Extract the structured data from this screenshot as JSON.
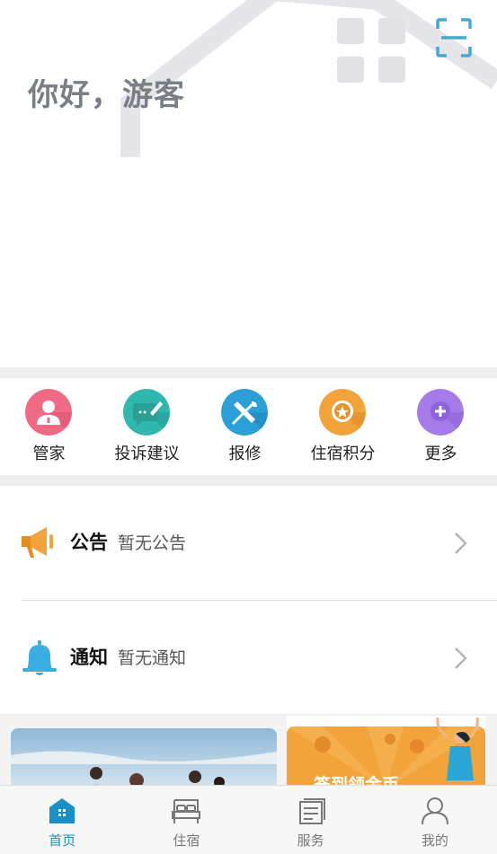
{
  "header": {
    "greeting": "你好，游客",
    "grid_icon": "apps-grid-icon",
    "scan_icon": "scan-icon"
  },
  "quick_menu": [
    {
      "label": "管家",
      "icon": "butler-icon",
      "color": "#f06a86"
    },
    {
      "label": "投诉建议",
      "icon": "feedback-icon",
      "color": "#2fb8ad"
    },
    {
      "label": "报修",
      "icon": "repair-icon",
      "color": "#2a9fd8"
    },
    {
      "label": "住宿积分",
      "icon": "points-icon",
      "color": "#f2a33a"
    },
    {
      "label": "更多",
      "icon": "more-icon",
      "color": "#a57be8"
    }
  ],
  "notices": {
    "announcement": {
      "title": "公告",
      "value": "暂无公告",
      "icon": "megaphone-icon"
    },
    "notification": {
      "title": "通知",
      "value": "暂无通知",
      "icon": "bell-icon"
    }
  },
  "banners": {
    "right_text": "签到领金币"
  },
  "tabbar": [
    {
      "label": "首页",
      "icon": "home-icon",
      "active": true
    },
    {
      "label": "住宿",
      "icon": "bed-icon",
      "active": false
    },
    {
      "label": "服务",
      "icon": "service-icon",
      "active": false
    },
    {
      "label": "我的",
      "icon": "profile-icon",
      "active": false
    }
  ],
  "colors": {
    "accent": "#1a8fc5",
    "greeting": "#7a7f86"
  }
}
